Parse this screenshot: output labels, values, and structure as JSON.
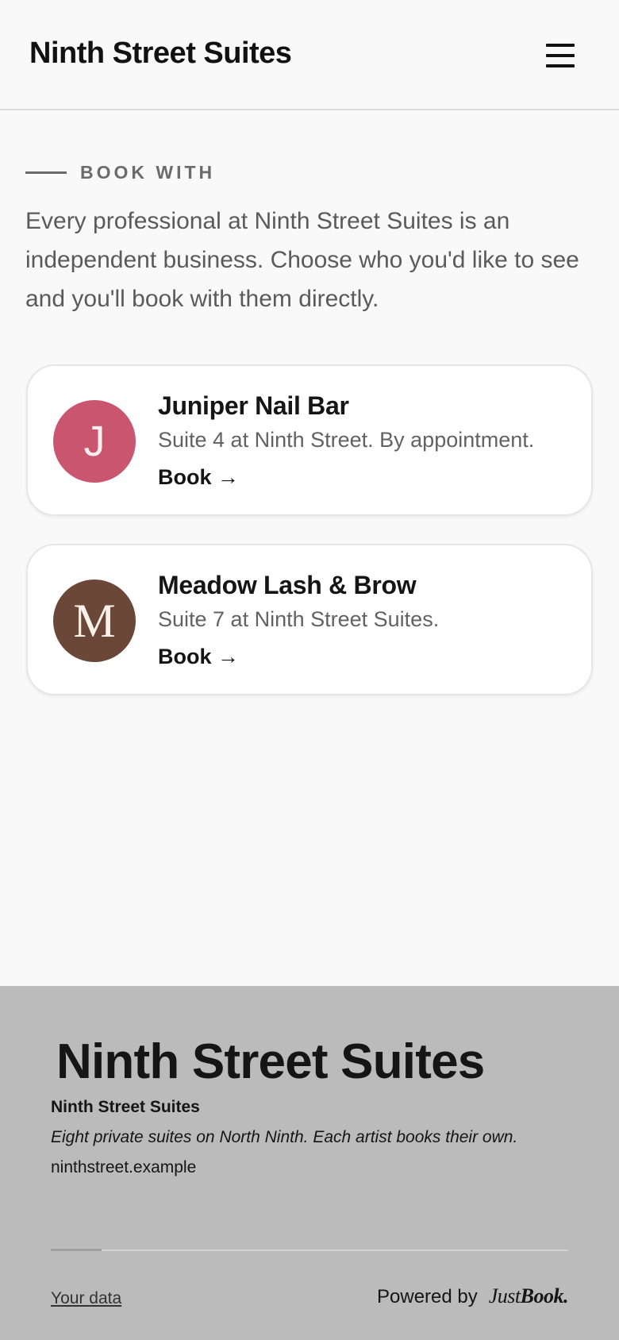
{
  "header": {
    "title": "Ninth Street Suites",
    "menu_icon": "hamburger-menu-icon"
  },
  "intro": {
    "eyebrow": "BOOK WITH",
    "text": "Every professional at Ninth Street Suites is an independent business. Choose who you'd like to see and you'll book with them directly."
  },
  "providers": [
    {
      "initial": "J",
      "name": "Juniper Nail Bar",
      "description": "Suite 4 at Ninth Street. By appointment.",
      "link": "Book →",
      "avatar_color": "#c9566e"
    },
    {
      "initial": "M",
      "name": "Meadow Lash & Brow",
      "description": "Suite 7 at Ninth Street Suites.",
      "link": "Book →",
      "avatar_color": "#6a4737"
    }
  ],
  "footer": {
    "logo": "Ninth Street Suites",
    "name": "Ninth Street Suites",
    "tagline": "Eight private suites on North Ninth. Each artist books their own.",
    "url": "ninthstreet.example",
    "data_link": "Your data",
    "powered_by": "Powered by",
    "brand_prefix": "Just",
    "brand_suffix": "Book."
  },
  "colors": {
    "page_bg": "#f9f9f9",
    "footer_bg": "#bbbbbb",
    "text": "#151515",
    "muted_text": "#5a5a5a"
  }
}
